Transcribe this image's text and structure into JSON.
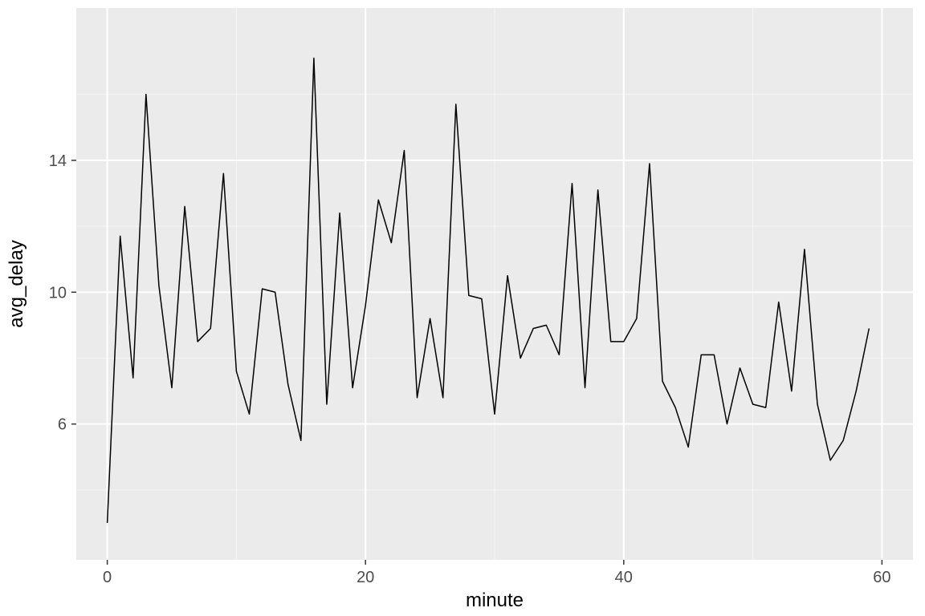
{
  "chart_data": {
    "type": "line",
    "xlabel": "minute",
    "ylabel": "avg_delay",
    "xlim": [
      0,
      60
    ],
    "ylim": [
      2.5,
      18
    ],
    "x_ticks": [
      0,
      20,
      40,
      60
    ],
    "y_ticks": [
      6,
      10,
      14
    ],
    "x": [
      0,
      1,
      2,
      3,
      4,
      5,
      6,
      7,
      8,
      9,
      10,
      11,
      12,
      13,
      14,
      15,
      16,
      17,
      18,
      19,
      20,
      21,
      22,
      23,
      24,
      25,
      26,
      27,
      28,
      29,
      30,
      31,
      32,
      33,
      34,
      35,
      36,
      37,
      38,
      39,
      40,
      41,
      42,
      43,
      44,
      45,
      46,
      47,
      48,
      49,
      50,
      51,
      52,
      53,
      54,
      55,
      56,
      57,
      58,
      59
    ],
    "values": [
      3.0,
      11.7,
      7.4,
      16.0,
      10.2,
      7.1,
      12.6,
      8.5,
      8.9,
      13.6,
      7.6,
      6.3,
      10.1,
      10.0,
      7.2,
      5.5,
      17.1,
      6.6,
      12.4,
      7.1,
      9.6,
      12.8,
      11.5,
      14.3,
      6.8,
      9.2,
      6.8,
      15.7,
      9.9,
      9.8,
      6.3,
      10.5,
      8.0,
      8.9,
      9.0,
      8.1,
      13.3,
      7.1,
      13.1,
      8.5,
      8.5,
      9.2,
      13.9,
      7.3,
      6.5,
      5.3,
      8.1,
      8.1,
      6.0,
      7.7,
      6.6,
      6.5,
      9.7,
      7.0,
      11.3,
      6.6,
      4.9,
      5.5,
      7.0,
      8.9
    ]
  },
  "layout": {
    "colors": {
      "panel_bg": "#ebebeb",
      "grid": "#ffffff",
      "line": "#000000",
      "text": "#4d4d4d"
    }
  }
}
